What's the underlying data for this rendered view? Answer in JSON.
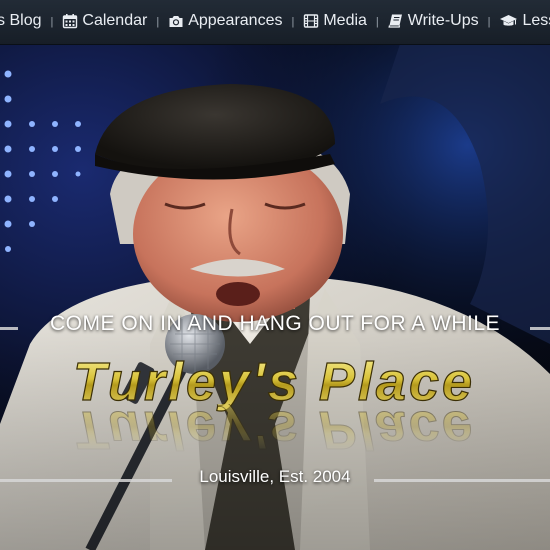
{
  "nav": {
    "items": [
      {
        "label": "'s Blog",
        "icon": ""
      },
      {
        "label": "Calendar",
        "icon": "calendar-icon"
      },
      {
        "label": "Appearances",
        "icon": "camera-icon"
      },
      {
        "label": "Media",
        "icon": "film-icon"
      },
      {
        "label": "Write-Ups",
        "icon": "book-icon"
      },
      {
        "label": "Less",
        "icon": "graduation-cap-icon"
      }
    ],
    "separator": "|"
  },
  "hero": {
    "tagline": "COME ON IN AND HANG OUT FOR A WHILE",
    "logo_text": "Turley's Place",
    "subtitle": "Louisville, Est. 2004"
  },
  "colors": {
    "nav_bg": "#1c232d",
    "logo_gold": "#d8c23a",
    "text": "#ffffff"
  }
}
